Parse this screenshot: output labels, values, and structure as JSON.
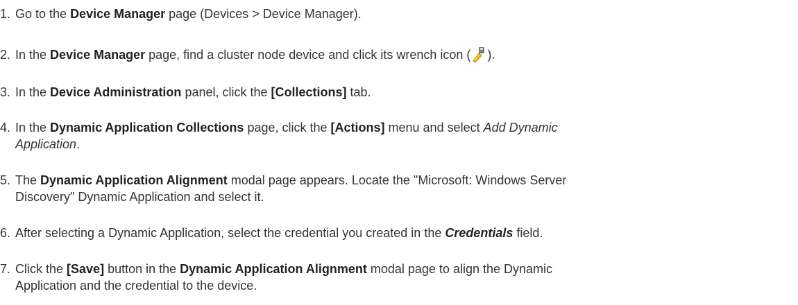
{
  "steps": [
    {
      "num": "1.",
      "parts": [
        "Go to the ",
        "Device Manager",
        " page (Devices > Device Manager)."
      ]
    },
    {
      "num": "2.",
      "parts": [
        "In the ",
        "Device Manager",
        " page, find a cluster node device and click its wrench icon (",
        ")."
      ],
      "icon": "wrench-icon"
    },
    {
      "num": "3.",
      "parts": [
        "In the ",
        "Device Administration",
        " panel, click the ",
        "[Collections]",
        " tab."
      ]
    },
    {
      "num": "4.",
      "parts": [
        "In the ",
        "Dynamic Application Collections",
        " page, click the ",
        "[Actions]",
        " menu and select ",
        "Add Dynamic",
        "Application",
        "."
      ]
    },
    {
      "num": "5.",
      "parts": [
        "The ",
        "Dynamic Application Alignment",
        " modal page appears. Locate the \"Microsoft: Windows Server",
        "Discovery\" Dynamic Application and select it."
      ]
    },
    {
      "num": "6.",
      "parts": [
        "After selecting a Dynamic Application, select the credential you created in the ",
        "Credentials",
        " field."
      ]
    },
    {
      "num": "7.",
      "parts": [
        "Click the ",
        "[Save]",
        " button in the ",
        "Dynamic Application Alignment",
        " modal page to align the Dynamic",
        "Application and the credential to the device."
      ]
    }
  ]
}
